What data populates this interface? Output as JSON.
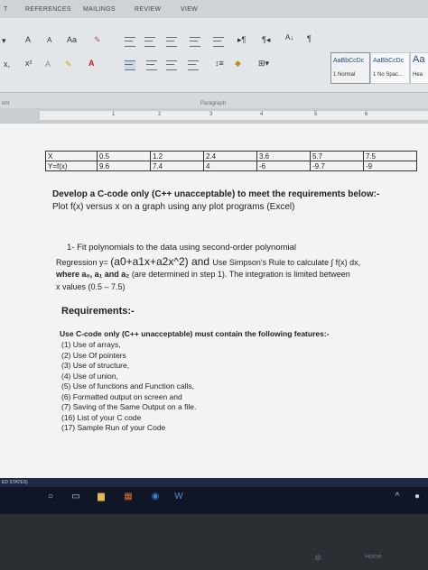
{
  "ribbon": {
    "tabs": [
      "T",
      "REFERENCES",
      "MAILINGS",
      "REVIEW",
      "VIEW"
    ],
    "font_controls": {
      "grow": "A",
      "shrink": "A",
      "case": "Aa",
      "sub": "x,",
      "sup": "x²",
      "color_a": "A"
    },
    "styles": [
      {
        "preview": "AaBbCcDc",
        "name": "1 Normal"
      },
      {
        "preview": "AaBbCcDc",
        "name": "1 No Spac..."
      },
      {
        "preview": "Aa",
        "name": "Hea"
      }
    ],
    "groups": {
      "font": "ont",
      "paragraph": "Paragraph"
    }
  },
  "ruler": {
    "numbers": [
      "1",
      "2",
      "3",
      "4",
      "5",
      "6"
    ]
  },
  "document": {
    "table": {
      "x_row": [
        "X",
        "0.5",
        "1.2",
        "2.4",
        "3.6",
        "5.7",
        "7.5"
      ],
      "y_row": [
        "Y=f(x)",
        "9.6",
        "7.4",
        "4",
        "-6",
        "-9.7",
        "-9"
      ]
    },
    "heading": "Develop a C-code only (C++ unacceptable) to meet the requirements below:-",
    "plot_line": "Plot f(x) versus x on a graph using any plot programs (Excel)",
    "step1": {
      "line1": "1-  Fit polynomials to the data using second-order polynomial",
      "regression_prefix": "Regression y= ",
      "regression_formula": "(a0+a1x+a2x^2)",
      "and": " and ",
      "simpson": "Use Simpson's Rule to calculate ∫ f(x) dx,",
      "where_prefix": "where a₀, a₁ and a₂",
      "where_rest": " (are determined in step 1). The integration is limited between",
      "x_values": "x values (0.5 – 7.5)"
    },
    "requirements_title": "Requirements:-",
    "c_code_line": "Use C-code only (C++ unacceptable) must contain the following features:-",
    "features": [
      "(1) Use of arrays,",
      "(2) Use Of pointers",
      "(3) Use of structure,",
      "(4) Use of union,",
      "(5) Use of functions and Function calls,",
      "(6) Formatted output on screen and",
      "(7) Saving of the Same Output on a file.",
      "(16) List of your C code",
      "(17) Sample Run of your Code"
    ]
  },
  "taskbar": {
    "label": "ED STATES)"
  },
  "bezel": {
    "home_label": "Home"
  }
}
